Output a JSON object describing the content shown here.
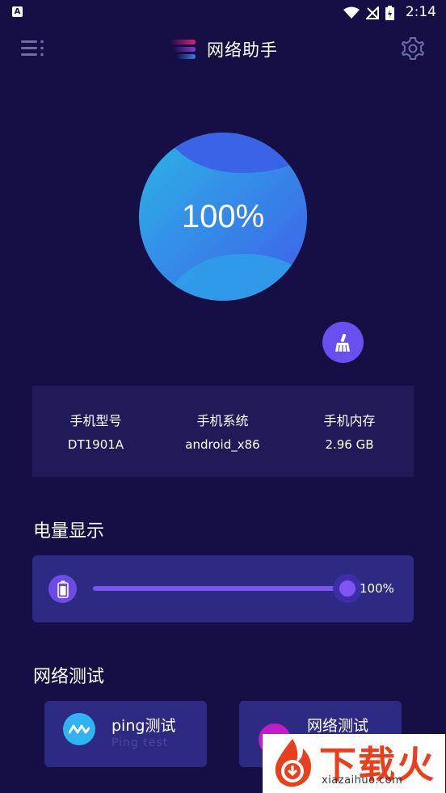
{
  "status_bar": {
    "app_icon_letter": "A",
    "time": "2:14"
  },
  "header": {
    "title": "网络助手"
  },
  "battery": {
    "percent_label": "100%",
    "level_percent": 100
  },
  "phone_info": {
    "items": [
      {
        "label": "手机型号",
        "value": "DT1901A"
      },
      {
        "label": "手机系统",
        "value": "android_x86"
      },
      {
        "label": "手机内存",
        "value": "2.96 GB"
      }
    ]
  },
  "battery_display": {
    "title": "电量显示",
    "value_label": "100%"
  },
  "network_test": {
    "title": "网络测试",
    "ping": {
      "label": "ping测试",
      "sublabel": "Ping test"
    },
    "network": {
      "label": "网络测试"
    }
  },
  "watermark": {
    "text": "下载火",
    "site": "xiazaihuo.com"
  },
  "colors": {
    "background": "#150f45",
    "card": "#2c2a82",
    "accent": "#7e55f2",
    "ping_icon": "#2fb3f1",
    "net_icon": "#c51cc8"
  }
}
